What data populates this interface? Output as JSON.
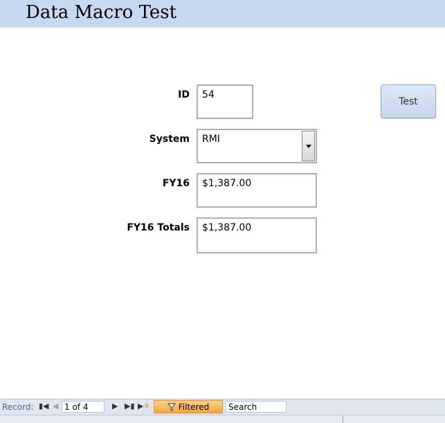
{
  "form": {
    "title": "Data Macro Test",
    "fields": {
      "id": {
        "label": "ID",
        "value": "54"
      },
      "system": {
        "label": "System",
        "value": "RMI"
      },
      "fy16": {
        "label": "FY16",
        "value": "$1,387.00"
      },
      "fy16_totals": {
        "label": "FY16 Totals",
        "value": "$1,387.00"
      }
    },
    "test_button": "Test"
  },
  "navigation": {
    "record_label": "Record:",
    "first_icon": "first-record-icon",
    "prev_icon": "previous-record-icon",
    "current": "1 of 4",
    "next_icon": "next-record-icon",
    "last_icon": "last-record-icon",
    "new_icon": "new-record-icon",
    "filter_label": "Filtered",
    "filter_icon": "funnel-icon",
    "search_placeholder": "Search"
  },
  "colors": {
    "header_bg": "#c6d9f0",
    "filter_bg": "#f5a742",
    "button_bg": "#c5d6ee"
  }
}
